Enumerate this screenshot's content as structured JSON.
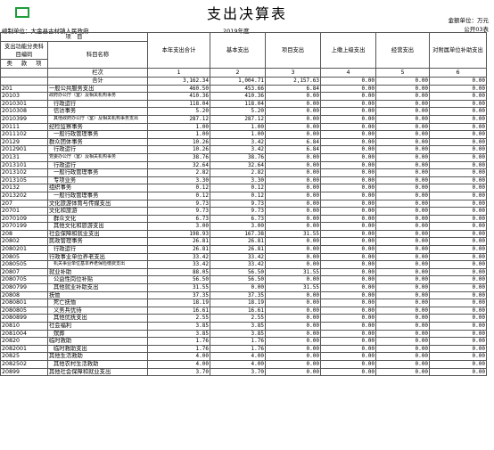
{
  "title": "支出决算表",
  "unit_label": "金额单位：万元",
  "form_no": "公开03表",
  "org_label": "编制单位：大金县古村镇人民政府",
  "year_label": "2019年度",
  "header": {
    "item_label": "项　目",
    "code_label": "支出功能分类科目编码",
    "name_label": "科目名称",
    "sub_labels": [
      "类",
      "款",
      "项"
    ],
    "cols": [
      "本年支出合计",
      "基本支出",
      "项目支出",
      "上缴上级支出",
      "经营支出",
      "对附属单位补助支出"
    ],
    "col_idx_label": "栏次",
    "col_nums": [
      "1",
      "2",
      "3",
      "4",
      "5",
      "6"
    ],
    "total_label": "合计",
    "total": [
      "3,162.34",
      "1,004.71",
      "2,157.63",
      "0.00",
      "0.00",
      "0.00"
    ]
  },
  "rows": [
    {
      "code": "201",
      "name": "一般公共服务支出",
      "lvl": 0,
      "v": [
        "460.50",
        "453.66",
        "6.84",
        "0.00",
        "0.00",
        "0.00"
      ]
    },
    {
      "code": "20103",
      "name": "政府办公厅（室）及相关机构事务",
      "lvl": 0,
      "v": [
        "410.36",
        "410.36",
        "0.00",
        "0.00",
        "0.00",
        "0.00"
      ]
    },
    {
      "code": "2010301",
      "name": "行政运行",
      "lvl": 1,
      "v": [
        "118.04",
        "118.04",
        "0.00",
        "0.00",
        "0.00",
        "0.00"
      ]
    },
    {
      "code": "2010308",
      "name": "信访事务",
      "lvl": 1,
      "v": [
        "5.20",
        "5.20",
        "0.00",
        "0.00",
        "0.00",
        "0.00"
      ]
    },
    {
      "code": "2010399",
      "name": "其他政府办公厅（室）及相关机构事务支出",
      "lvl": 1,
      "v": [
        "287.12",
        "287.12",
        "0.00",
        "0.00",
        "0.00",
        "0.00"
      ]
    },
    {
      "code": "20111",
      "name": "纪检监察事务",
      "lvl": 0,
      "v": [
        "1.00",
        "1.00",
        "0.00",
        "0.00",
        "0.00",
        "0.00"
      ]
    },
    {
      "code": "2011102",
      "name": "一般行政管理事务",
      "lvl": 1,
      "v": [
        "1.00",
        "1.00",
        "0.00",
        "0.00",
        "0.00",
        "0.00"
      ]
    },
    {
      "code": "20129",
      "name": "群众团体事务",
      "lvl": 0,
      "v": [
        "10.26",
        "3.42",
        "6.84",
        "0.00",
        "0.00",
        "0.00"
      ]
    },
    {
      "code": "2012901",
      "name": "行政运行",
      "lvl": 1,
      "v": [
        "10.26",
        "3.42",
        "6.84",
        "0.00",
        "0.00",
        "0.00"
      ]
    },
    {
      "code": "20131",
      "name": "党委办公厅（室）及相关机构事务",
      "lvl": 0,
      "v": [
        "38.76",
        "38.76",
        "0.00",
        "0.00",
        "0.00",
        "0.00"
      ]
    },
    {
      "code": "2013101",
      "name": "行政运行",
      "lvl": 1,
      "v": [
        "32.64",
        "32.64",
        "0.00",
        "0.00",
        "0.00",
        "0.00"
      ]
    },
    {
      "code": "2013102",
      "name": "一般行政管理事务",
      "lvl": 1,
      "v": [
        "2.82",
        "2.82",
        "0.00",
        "0.00",
        "0.00",
        "0.00"
      ]
    },
    {
      "code": "2013105",
      "name": "专项业务",
      "lvl": 1,
      "v": [
        "3.30",
        "3.30",
        "0.00",
        "0.00",
        "0.00",
        "0.00"
      ]
    },
    {
      "code": "20132",
      "name": "组织事务",
      "lvl": 0,
      "v": [
        "0.12",
        "0.12",
        "0.00",
        "0.00",
        "0.00",
        "0.00"
      ]
    },
    {
      "code": "2013202",
      "name": "一般行政管理事务",
      "lvl": 1,
      "v": [
        "0.12",
        "0.12",
        "0.00",
        "0.00",
        "0.00",
        "0.00"
      ]
    },
    {
      "code": "207",
      "name": "文化旅游体育与传媒支出",
      "lvl": 0,
      "v": [
        "9.73",
        "9.73",
        "0.00",
        "0.00",
        "0.00",
        "0.00"
      ]
    },
    {
      "code": "20701",
      "name": "文化和旅游",
      "lvl": 0,
      "v": [
        "9.73",
        "9.73",
        "0.00",
        "0.00",
        "0.00",
        "0.00"
      ]
    },
    {
      "code": "2070109",
      "name": "群众文化",
      "lvl": 1,
      "v": [
        "6.73",
        "6.73",
        "0.00",
        "0.00",
        "0.00",
        "0.00"
      ]
    },
    {
      "code": "2070199",
      "name": "其他文化和旅游支出",
      "lvl": 1,
      "v": [
        "3.00",
        "3.00",
        "0.00",
        "0.00",
        "0.00",
        "0.00"
      ]
    },
    {
      "code": "208",
      "name": "社会保障和就业支出",
      "lvl": 0,
      "v": [
        "198.93",
        "167.38",
        "31.55",
        "0.00",
        "0.00",
        "0.00"
      ]
    },
    {
      "code": "20802",
      "name": "民政管理事务",
      "lvl": 0,
      "v": [
        "26.81",
        "26.81",
        "0.00",
        "0.00",
        "0.00",
        "0.00"
      ]
    },
    {
      "code": "2080201",
      "name": "行政运行",
      "lvl": 1,
      "v": [
        "26.81",
        "26.81",
        "0.00",
        "0.00",
        "0.00",
        "0.00"
      ]
    },
    {
      "code": "20805",
      "name": "行政事业单位养老支出",
      "lvl": 0,
      "v": [
        "33.42",
        "33.42",
        "0.00",
        "0.00",
        "0.00",
        "0.00"
      ]
    },
    {
      "code": "2080505",
      "name": "机关事业单位基本养老保险缴费支出",
      "lvl": 1,
      "v": [
        "33.42",
        "33.42",
        "0.00",
        "0.00",
        "0.00",
        "0.00"
      ]
    },
    {
      "code": "20807",
      "name": "就业补助",
      "lvl": 0,
      "v": [
        "88.05",
        "56.50",
        "31.55",
        "0.00",
        "0.00",
        "0.00"
      ]
    },
    {
      "code": "2080705",
      "name": "公益性岗位补贴",
      "lvl": 1,
      "v": [
        "56.50",
        "56.50",
        "0.00",
        "0.00",
        "0.00",
        "0.00"
      ]
    },
    {
      "code": "2080799",
      "name": "其他就业补助支出",
      "lvl": 1,
      "v": [
        "31.55",
        "0.00",
        "31.55",
        "0.00",
        "0.00",
        "0.00"
      ]
    },
    {
      "code": "20808",
      "name": "抚恤",
      "lvl": 0,
      "v": [
        "37.35",
        "37.35",
        "0.00",
        "0.00",
        "0.00",
        "0.00"
      ]
    },
    {
      "code": "2080801",
      "name": "死亡抚恤",
      "lvl": 1,
      "v": [
        "18.19",
        "18.19",
        "0.00",
        "0.00",
        "0.00",
        "0.00"
      ]
    },
    {
      "code": "2080805",
      "name": "义务兵优待",
      "lvl": 1,
      "v": [
        "16.61",
        "16.61",
        "0.00",
        "0.00",
        "0.00",
        "0.00"
      ]
    },
    {
      "code": "2080899",
      "name": "其他优抚支出",
      "lvl": 1,
      "v": [
        "2.55",
        "2.55",
        "0.00",
        "0.00",
        "0.00",
        "0.00"
      ]
    },
    {
      "code": "20810",
      "name": "社会福利",
      "lvl": 0,
      "v": [
        "3.85",
        "3.85",
        "0.00",
        "0.00",
        "0.00",
        "0.00"
      ]
    },
    {
      "code": "2081004",
      "name": "殡葬",
      "lvl": 1,
      "v": [
        "3.85",
        "3.85",
        "0.00",
        "0.00",
        "0.00",
        "0.00"
      ]
    },
    {
      "code": "20820",
      "name": "临时救助",
      "lvl": 0,
      "v": [
        "1.76",
        "1.76",
        "0.00",
        "0.00",
        "0.00",
        "0.00"
      ]
    },
    {
      "code": "2082001",
      "name": "临时救助支出",
      "lvl": 1,
      "v": [
        "1.76",
        "1.76",
        "0.00",
        "0.00",
        "0.00",
        "0.00"
      ]
    },
    {
      "code": "20825",
      "name": "其他生活救助",
      "lvl": 0,
      "v": [
        "4.00",
        "4.00",
        "0.00",
        "0.00",
        "0.00",
        "0.00"
      ]
    },
    {
      "code": "2082502",
      "name": "其他农村生活救助",
      "lvl": 1,
      "v": [
        "4.00",
        "4.00",
        "0.00",
        "0.00",
        "0.00",
        "0.00"
      ]
    },
    {
      "code": "20899",
      "name": "其他社会保障和就业支出",
      "lvl": 0,
      "v": [
        "3.70",
        "3.70",
        "0.00",
        "0.00",
        "0.00",
        "0.00"
      ]
    }
  ]
}
